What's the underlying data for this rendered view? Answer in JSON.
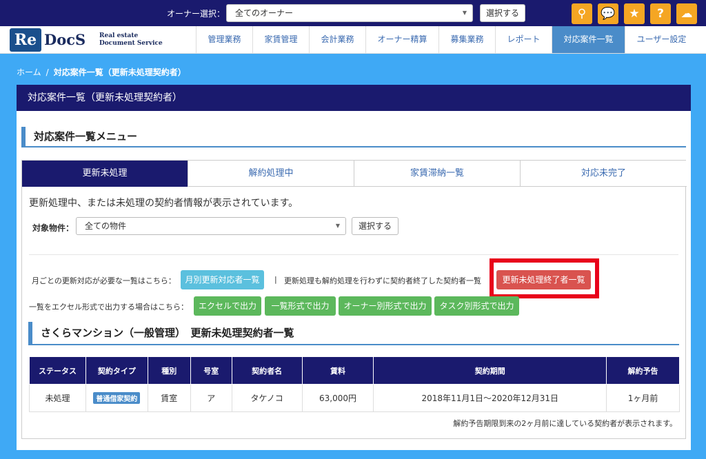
{
  "topbar": {
    "owner_label": "オーナー選択：",
    "owner_value": "全てのオーナー",
    "select_button": "選択する",
    "icons": [
      {
        "name": "search-icon",
        "glyph": "⚲"
      },
      {
        "name": "chat-icon",
        "glyph": "💬"
      },
      {
        "name": "star-icon",
        "glyph": "★"
      },
      {
        "name": "help-icon",
        "glyph": "?"
      },
      {
        "name": "cloud-icon",
        "glyph": "☁"
      }
    ],
    "icon_color": "#f5a623",
    "bg_color": "#1a1a6e"
  },
  "logo": {
    "re": "Re",
    "docs": "DocS",
    "sub1": "Real estate",
    "sub2": "Document Service"
  },
  "nav": {
    "items": [
      {
        "label": "管理業務"
      },
      {
        "label": "家賃管理"
      },
      {
        "label": "会計業務"
      },
      {
        "label": "オーナー精算"
      },
      {
        "label": "募集業務"
      },
      {
        "label": "レポート"
      },
      {
        "label": "対応案件一覧",
        "active": true
      },
      {
        "label": "ユーザー設定"
      }
    ]
  },
  "breadcrumb": {
    "home": "ホーム",
    "sep": "/",
    "current": "対応案件一覧（更新未処理契約者）"
  },
  "panel": {
    "header": "対応案件一覧（更新未処理契約者）",
    "section_title": "対応案件一覧メニュー",
    "tabs": [
      "更新未処理",
      "解約処理中",
      "家賃滞納一覧",
      "対応未完了"
    ],
    "description": "更新処理中、または未処理の契約者情報が表示されています。",
    "property_label": "対象物件：",
    "property_value": "全ての物件",
    "property_button": "選択する",
    "monthly_text": "月ごとの更新対応が必要な一覧はこちら：",
    "monthly_button": "月別更新対応者一覧",
    "pipe": "|",
    "ended_text": "更新処理も解約処理を行わずに契約者終了した契約者一覧",
    "ended_button": "更新未処理終了者一覧",
    "excel_text": "一覧をエクセル形式で出力する場合はこちら：",
    "excel_buttons": [
      "エクセルで出力",
      "一覧形式で出力",
      "オーナー別形式で出力",
      "タスク別形式で出力"
    ],
    "property_section": "さくらマンション（一般管理）　更新未処理契約者一覧",
    "table_headers": [
      "ステータス",
      "契約タイプ",
      "種別",
      "号室",
      "契約者名",
      "賃料",
      "契約期間",
      "解約予告"
    ],
    "table_rows": [
      {
        "status": "未処理",
        "type": "普通借家契約",
        "kind": "賃室",
        "room": "ア",
        "name": "タケノコ",
        "rent": "63,000円",
        "period": "2018年11月1日～2020年12月31日",
        "notice": "1ヶ月前"
      }
    ],
    "note": "解約予告期限到来の2ヶ月前に達している契約者が表示されます。"
  }
}
